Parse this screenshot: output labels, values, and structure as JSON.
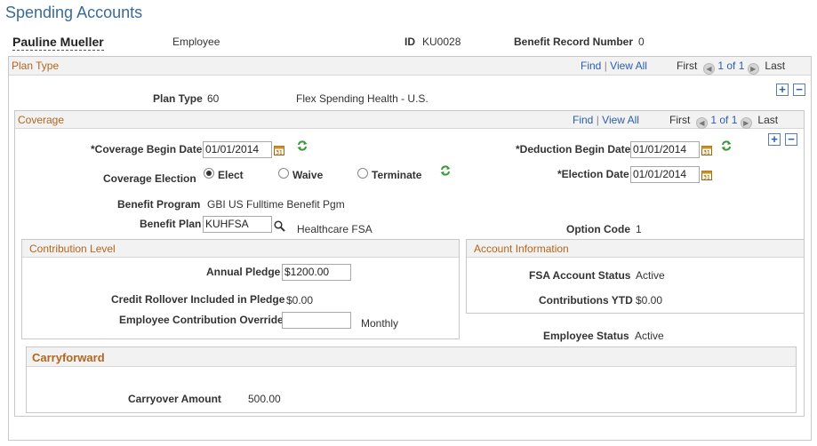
{
  "page": {
    "title": "Spending Accounts"
  },
  "employee": {
    "name": "Pauline Mueller",
    "role": "Employee",
    "id_label": "ID",
    "id_value": "KU0028",
    "benefit_record_label": "Benefit Record Number",
    "benefit_record_value": "0"
  },
  "nav": {
    "find": "Find",
    "sep": "|",
    "view_all": "View All",
    "first": "First",
    "range": "1 of 1",
    "last": "Last"
  },
  "plan_type_section": {
    "title": "Plan Type",
    "plan_type_label": "Plan Type",
    "plan_type_code": "60",
    "plan_type_desc": "Flex Spending Health - U.S."
  },
  "coverage": {
    "title": "Coverage",
    "coverage_begin_label": "*Coverage Begin Date",
    "coverage_begin_value": "01/01/2014",
    "deduction_begin_label": "*Deduction Begin Date",
    "deduction_begin_value": "01/01/2014",
    "coverage_election_label": "Coverage Election",
    "election_options": [
      "Elect",
      "Waive",
      "Terminate"
    ],
    "election_selected": "Elect",
    "election_date_label": "*Election Date",
    "election_date_value": "01/01/2014",
    "benefit_program_label": "Benefit Program",
    "benefit_program_value": "GBI US Fulltime Benefit Pgm",
    "benefit_plan_label": "Benefit Plan",
    "benefit_plan_value": "KUHFSA",
    "benefit_plan_desc": "Healthcare FSA",
    "option_code_label": "Option Code",
    "option_code_value": "1"
  },
  "contribution": {
    "title": "Contribution Level",
    "annual_pledge_label": "Annual Pledge",
    "annual_pledge_value": "$1200.00",
    "rollover_label": "Credit Rollover Included in Pledge",
    "rollover_value": "$0.00",
    "override_label": "Employee Contribution Override",
    "override_value": "",
    "frequency": "Monthly"
  },
  "account_info": {
    "title": "Account Information",
    "fsa_status_label": "FSA Account Status",
    "fsa_status_value": "Active",
    "contrib_ytd_label": "Contributions YTD",
    "contrib_ytd_value": "$0.00"
  },
  "employee_status": {
    "label": "Employee Status",
    "value": "Active"
  },
  "carryforward": {
    "title": "Carryforward",
    "carryover_label": "Carryover Amount",
    "carryover_value": "500.00"
  },
  "colors": {
    "title_blue": "#3a6a9c",
    "section_orange": "#b5651d",
    "link_blue": "#2a5db0",
    "refresh_green": "#3a9a3a"
  }
}
